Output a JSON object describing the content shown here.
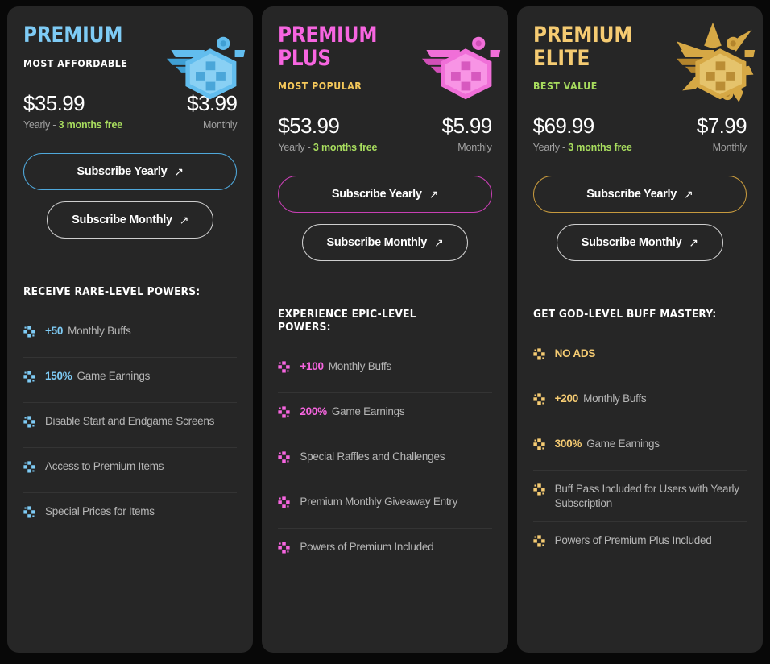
{
  "page": {
    "background": "#080808",
    "card_background": "#262626",
    "divider_color": "#343434",
    "free_text_color": "#a8dd5e"
  },
  "plans": [
    {
      "id": "premium",
      "title": "PREMIUM",
      "tag": "MOST AFFORDABLE",
      "accent": "#7ecbf5",
      "tag_color": "#ffffff",
      "badge_icon": "winged-hex-medal-icon",
      "badge_colors": {
        "light": "#a9e0fa",
        "mid": "#62bdee",
        "dark": "#3f9fd4"
      },
      "yearly_price": "$35.99",
      "yearly_label_prefix": "Yearly - ",
      "yearly_label_free": "3 months free",
      "monthly_price": "$3.99",
      "monthly_label": "Monthly",
      "yearly_button": "Subscribe Yearly",
      "monthly_button": "Subscribe Monthly",
      "yearly_button_border": "#4fa8db",
      "monthly_button_border": "#cfcfcf",
      "features_heading": "RECEIVE RARE-LEVEL POWERS:",
      "features": [
        {
          "highlight": "+50",
          "text": "Monthly Buffs"
        },
        {
          "highlight": "150%",
          "text": "Game Earnings"
        },
        {
          "highlight": "",
          "text": "Disable Start and Endgame Screens"
        },
        {
          "highlight": "",
          "text": "Access to Premium Items"
        },
        {
          "highlight": "",
          "text": "Special Prices for Items"
        }
      ]
    },
    {
      "id": "premium-plus",
      "title": "PREMIUM\nPLUS",
      "tag": "MOST POPULAR",
      "accent": "#f765e0",
      "tag_color": "#f5c85a",
      "badge_icon": "winged-hex-medal-icon",
      "badge_colors": {
        "light": "#ffb3f0",
        "mid": "#f06fd8",
        "dark": "#d14fb8"
      },
      "yearly_price": "$53.99",
      "yearly_label_prefix": "Yearly - ",
      "yearly_label_free": "3 months free",
      "monthly_price": "$5.99",
      "monthly_label": "Monthly",
      "yearly_button": "Subscribe Yearly",
      "monthly_button": "Subscribe Monthly",
      "yearly_button_border": "#c83fb4",
      "monthly_button_border": "#cfcfcf",
      "features_heading": "EXPERIENCE EPIC-LEVEL POWERS:",
      "features": [
        {
          "highlight": "+100",
          "text": "Monthly Buffs"
        },
        {
          "highlight": "200%",
          "text": "Game Earnings"
        },
        {
          "highlight": "",
          "text": "Special Raffles and Challenges"
        },
        {
          "highlight": "",
          "text": "Premium Monthly Giveaway Entry"
        },
        {
          "highlight": "",
          "text": "Powers of Premium Included"
        }
      ]
    },
    {
      "id": "premium-elite",
      "title": "PREMIUM\nELITE",
      "tag": "BEST VALUE",
      "accent": "#f5cb72",
      "tag_color": "#a8dd5e",
      "badge_icon": "gold-starburst-medal-icon",
      "badge_colors": {
        "light": "#f3d88c",
        "mid": "#d6a845",
        "dark": "#b3842c"
      },
      "yearly_price": "$69.99",
      "yearly_label_prefix": "Yearly - ",
      "yearly_label_free": "3 months free",
      "monthly_price": "$7.99",
      "monthly_label": "Monthly",
      "yearly_button": "Subscribe Yearly",
      "monthly_button": "Subscribe Monthly",
      "yearly_button_border": "#c79a3e",
      "monthly_button_border": "#cfcfcf",
      "features_heading": "GET GOD-LEVEL BUFF MASTERY:",
      "features": [
        {
          "highlight": "NO ADS",
          "text": "",
          "all_highlight": true
        },
        {
          "highlight": "+200",
          "text": "Monthly Buffs"
        },
        {
          "highlight": "300%",
          "text": "Game Earnings"
        },
        {
          "highlight": "",
          "text": "Buff Pass Included for Users with Yearly Subscription"
        },
        {
          "highlight": "",
          "text": "Powers of Premium Plus Included"
        }
      ]
    }
  ],
  "icons": {
    "arrow": "↗",
    "bullet": "four-square-cross-icon"
  }
}
